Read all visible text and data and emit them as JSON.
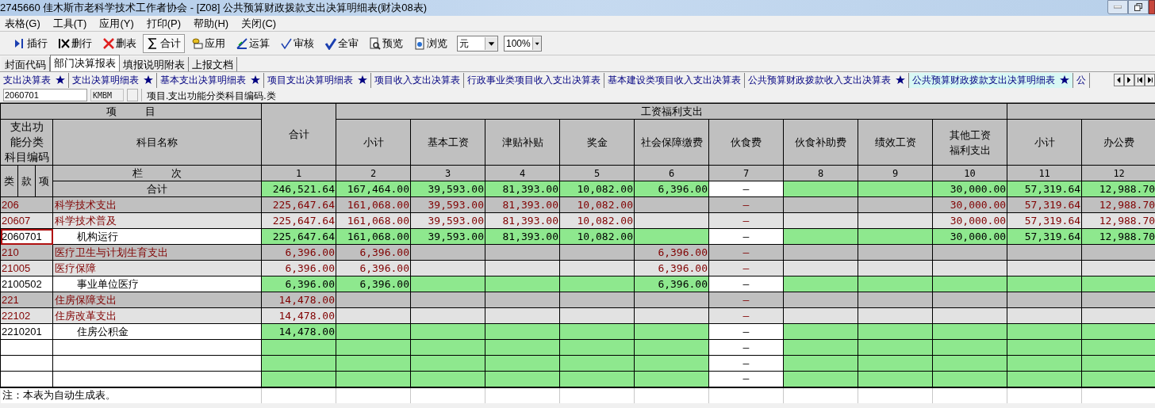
{
  "window": {
    "title": "2745660  佳木斯市老科学技术工作者协会 - [Z08] 公共预算财政拨款支出决算明细表(财决08表)"
  },
  "menu": [
    "表格(G)",
    "工具(T)",
    "应用(Y)",
    "打印(P)",
    "帮助(H)",
    "关闭(C)"
  ],
  "toolbar": [
    {
      "label": "插行",
      "pressed": false
    },
    {
      "label": "删行",
      "pressed": false
    },
    {
      "label": "删表",
      "pressed": false
    },
    {
      "label": "合计",
      "pressed": true
    },
    {
      "label": "应用",
      "pressed": false
    },
    {
      "label": "运算",
      "pressed": false
    },
    {
      "label": "审核",
      "pressed": false
    },
    {
      "label": "全审",
      "pressed": false
    },
    {
      "label": "预览",
      "pressed": false
    },
    {
      "label": "浏览",
      "pressed": false
    }
  ],
  "unit_select": {
    "value": "元"
  },
  "zoom_select": {
    "value": "100%"
  },
  "tabs": [
    {
      "label": "封面代码",
      "selected": false
    },
    {
      "label": "部门决算报表",
      "selected": true
    },
    {
      "label": "填报说明附表",
      "selected": false
    },
    {
      "label": "上报文档",
      "selected": false
    }
  ],
  "sheet_tabs": [
    {
      "label": "支出决算表",
      "starred": true,
      "selected": false
    },
    {
      "label": "支出决算明细表",
      "starred": true,
      "selected": false
    },
    {
      "label": "基本支出决算明细表",
      "starred": true,
      "selected": false
    },
    {
      "label": "项目支出决算明细表",
      "starred": true,
      "selected": false
    },
    {
      "label": "项目收入支出决算表",
      "starred": false,
      "selected": false
    },
    {
      "label": "行政事业类项目收入支出决算表",
      "starred": false,
      "selected": false
    },
    {
      "label": "基本建设类项目收入支出决算表",
      "starred": false,
      "selected": false
    },
    {
      "label": "公共预算财政拨款收入支出决算表",
      "starred": true,
      "selected": false
    },
    {
      "label": "公共预算财政拨款支出决算明细表",
      "starred": true,
      "selected": true
    },
    {
      "label": "公",
      "starred": false,
      "selected": false
    }
  ],
  "formula_bar": {
    "cell_value": "2060701",
    "field_code": "KMBM",
    "field_path": "项目.支出功能分类科目编码.类"
  },
  "table": {
    "item_header": "项          目",
    "code_header_lines": [
      "支出功",
      "能分类",
      "科目编码"
    ],
    "name_header": "科目名称",
    "row_number_header": "栏          次",
    "code_subheaders": [
      "类",
      "款",
      "项"
    ],
    "total_column": {
      "label_lines": [
        "合计"
      ],
      "number": "1"
    },
    "groups": [
      {
        "label": "工资福利支出",
        "columns": [
          {
            "label_lines": [
              "小计"
            ],
            "number": "2"
          },
          {
            "label_lines": [
              "基本工资"
            ],
            "number": "3"
          },
          {
            "label_lines": [
              "津贴补贴"
            ],
            "number": "4"
          },
          {
            "label_lines": [
              "奖金"
            ],
            "number": "5"
          },
          {
            "label_lines": [
              "社会保障缴费"
            ],
            "number": "6"
          },
          {
            "label_lines": [
              "伙食费"
            ],
            "number": "7"
          },
          {
            "label_lines": [
              "伙食补助费"
            ],
            "number": "8"
          },
          {
            "label_lines": [
              "绩效工资"
            ],
            "number": "9"
          },
          {
            "label_lines": [
              "其他工资",
              "福利支出"
            ],
            "number": "10"
          }
        ]
      },
      {
        "columns": [
          {
            "label_lines": [
              "小计"
            ],
            "number": "11"
          },
          {
            "label_lines": [
              "办公费"
            ],
            "number": "12"
          }
        ]
      }
    ],
    "total_row": {
      "name": "合计",
      "values": {
        "c1": "246,521.64",
        "c2": "167,464.00",
        "c3": "39,593.00",
        "c4": "81,393.00",
        "c5": "10,082.00",
        "c6": "6,396.00",
        "c7": "—",
        "c10": "30,000.00",
        "c11": "57,319.64",
        "c12": "12,988.70"
      }
    },
    "rows": [
      {
        "kind": "category",
        "code": "206",
        "name": "科学技术支出",
        "selected": false,
        "values": {
          "c1": "225,647.64",
          "c2": "161,068.00",
          "c3": "39,593.00",
          "c4": "81,393.00",
          "c5": "10,082.00",
          "c7": "—",
          "c10": "30,000.00",
          "c11": "57,319.64",
          "c12": "12,988.70"
        }
      },
      {
        "kind": "section",
        "code": "20607",
        "name": "科学技术普及",
        "selected": false,
        "values": {
          "c1": "225,647.64",
          "c2": "161,068.00",
          "c3": "39,593.00",
          "c4": "81,393.00",
          "c5": "10,082.00",
          "c7": "—",
          "c10": "30,000.00",
          "c11": "57,319.64",
          "c12": "12,988.70"
        }
      },
      {
        "kind": "item",
        "code": "2060701",
        "name": "机构运行",
        "selected": true,
        "values": {
          "c1": "225,647.64",
          "c2": "161,068.00",
          "c3": "39,593.00",
          "c4": "81,393.00",
          "c5": "10,082.00",
          "c7": "—",
          "c10": "30,000.00",
          "c11": "57,319.64",
          "c12": "12,988.70"
        }
      },
      {
        "kind": "category",
        "code": "210",
        "name": "医疗卫生与计划生育支出",
        "selected": false,
        "values": {
          "c1": "6,396.00",
          "c2": "6,396.00",
          "c6": "6,396.00",
          "c7": "—"
        }
      },
      {
        "kind": "section",
        "code": "21005",
        "name": "医疗保障",
        "selected": false,
        "values": {
          "c1": "6,396.00",
          "c2": "6,396.00",
          "c6": "6,396.00",
          "c7": "—"
        }
      },
      {
        "kind": "item",
        "code": "2100502",
        "name": "事业单位医疗",
        "selected": false,
        "values": {
          "c1": "6,396.00",
          "c2": "6,396.00",
          "c6": "6,396.00",
          "c7": "—"
        }
      },
      {
        "kind": "category",
        "code": "221",
        "name": "住房保障支出",
        "selected": false,
        "values": {
          "c1": "14,478.00",
          "c7": "—"
        }
      },
      {
        "kind": "section",
        "code": "22102",
        "name": "住房改革支出",
        "selected": false,
        "values": {
          "c1": "14,478.00",
          "c7": "—"
        }
      },
      {
        "kind": "item",
        "code": "2210201",
        "name": "住房公积金",
        "selected": false,
        "values": {
          "c1": "14,478.00",
          "c7": "—"
        }
      },
      {
        "kind": "blank",
        "selected": false,
        "values": {
          "c7": "—"
        }
      },
      {
        "kind": "blank",
        "selected": false,
        "values": {
          "c7": "—"
        }
      },
      {
        "kind": "blank",
        "selected": false,
        "values": {
          "c7": "—"
        }
      }
    ],
    "note": "注：本表为自动生成表。"
  }
}
